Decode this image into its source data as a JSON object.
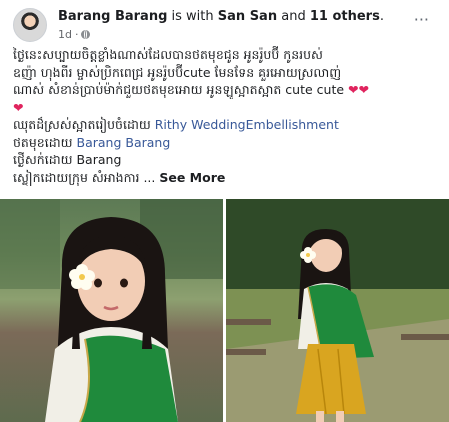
{
  "post": {
    "author": "Barang Barang",
    "with_text": "is with",
    "tagged_person": "San San",
    "and_text": "and",
    "others": "11 others",
    "period": ".",
    "time": "1d",
    "privacy_icon": "globe-icon",
    "more_icon": "more-options-icon",
    "more_label": "···"
  },
  "caption": {
    "line1": "ថ្ងៃនេះសប្បាយចិត្តខ្លាំងណាស់ដែលបានថតមុខជូន អូនរ៉ូបប៊ី កូនរបស់",
    "line2": "ឧញ៉ា ហុងពីរ ម្ចាស់ប្រិកពេជ្រ អូនរ៉ូបប៊ីcute មែនទែន គួរអោយស្រលាញ់",
    "line3a": "ណាស់  សំខាន់ប្រាប់ម៉ាក់ជួយថតមុខអោយ អូនឡូស្អាតស្អាត cute cute",
    "hearts1": "❤❤",
    "hearts2": "❤",
    "line4a": "ឈុតដ៏ស្រស់ស្អាតរៀបចំដោយ",
    "line4_link": "Rithy WeddingEmbellishment",
    "line5a": "ថតមុខដោយ",
    "line5_link": "Barang Barang",
    "line6": "ថ្ងើសក់ដោយ Barang",
    "line7": "ស្លៀកដោយក្រុម សំអាងការ ...",
    "see_more": "See More"
  },
  "colors": {
    "link": "#385898",
    "heart": "#e0245e",
    "text": "#1c1e21",
    "meta": "#65676b",
    "dress_green": "#1f8a3c",
    "skirt_gold": "#d9a520"
  }
}
